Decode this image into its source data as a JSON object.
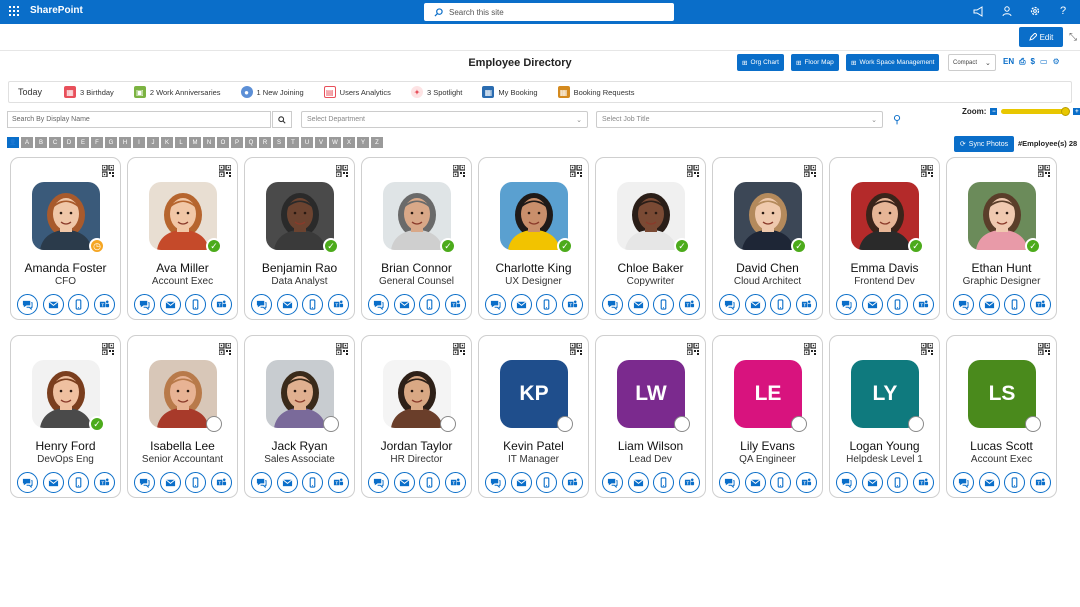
{
  "app": {
    "brand": "SharePoint",
    "search_placeholder": "Search this site",
    "edit_label": "Edit"
  },
  "header": {
    "title": "Employee Directory",
    "buttons": [
      "Org Chart",
      "Floor Map",
      "Work Space Management"
    ],
    "view_mode": "Compact",
    "language": "EN",
    "currency": "$"
  },
  "tabs": [
    {
      "label": "Today",
      "icon": "",
      "color": ""
    },
    {
      "label": "3 Birthday",
      "icon": "cake-icon",
      "color": "#e8505b"
    },
    {
      "label": "2 Work Anniversaries",
      "icon": "gift-icon",
      "color": "#7cb342"
    },
    {
      "label": "1 New Joining",
      "icon": "users-icon",
      "color": "#5c8fd6"
    },
    {
      "label": "Users Analytics",
      "icon": "analytics-icon",
      "color": "#e8505b"
    },
    {
      "label": "3 Spotlight",
      "icon": "spotlight-icon",
      "color": "#e8505b"
    },
    {
      "label": "My Booking",
      "icon": "calendar-icon",
      "color": "#2b6cb0"
    },
    {
      "label": "Booking Requests",
      "icon": "booking-icon",
      "color": "#d48a1f"
    }
  ],
  "filters": {
    "search_placeholder": "Search By Display Name",
    "department_placeholder": "Select Department",
    "job_title_placeholder": "Select Job Title",
    "zoom_label": "Zoom:",
    "zoom_level": 0.95
  },
  "alphabet": [
    "A",
    "B",
    "C",
    "D",
    "E",
    "F",
    "G",
    "H",
    "I",
    "J",
    "K",
    "L",
    "M",
    "N",
    "O",
    "P",
    "Q",
    "R",
    "S",
    "T",
    "U",
    "V",
    "W",
    "X",
    "Y",
    "Z"
  ],
  "sync_label": "Sync Photos",
  "employee_count": "#Employee(s) 28",
  "employees": [
    {
      "name": "Amanda Foster",
      "title": "CFO",
      "status": "away",
      "photo": "photo",
      "skin": "#f0c7a8",
      "hair": "#a85a2c",
      "bg": "#3a5a7a",
      "shirt": "#2b3b4b"
    },
    {
      "name": "Ava Miller",
      "title": "Account Exec",
      "status": "available",
      "photo": "photo",
      "skin": "#f1c7a6",
      "hair": "#b6652e",
      "bg": "#e8ded2",
      "shirt": "#c54a2a"
    },
    {
      "name": "Benjamin Rao",
      "title": "Data Analyst",
      "status": "available",
      "photo": "photo",
      "skin": "#6b4330",
      "hair": "#2a2a2a",
      "bg": "#4a4a4a",
      "shirt": "#3a3a3a"
    },
    {
      "name": "Brian Connor",
      "title": "General Counsel",
      "status": "available",
      "photo": "photo",
      "skin": "#d9a888",
      "hair": "#6a6a6a",
      "bg": "#dfe4e6",
      "shirt": "#cfcfcf"
    },
    {
      "name": "Charlotte King",
      "title": "UX Designer",
      "status": "available",
      "photo": "photo",
      "skin": "#c98f6b",
      "hair": "#1f1a18",
      "bg": "#5aa0d0",
      "shirt": "#f2c300"
    },
    {
      "name": "Chloe Baker",
      "title": "Copywriter",
      "status": "available",
      "photo": "photo",
      "skin": "#7a4a34",
      "hair": "#2a1e18",
      "bg": "#f0f0f0",
      "shirt": "#e6e6e6"
    },
    {
      "name": "David Chen",
      "title": "Cloud Architect",
      "status": "available",
      "photo": "photo",
      "skin": "#efc9ad",
      "hair": "#b48a5c",
      "bg": "#3c4756",
      "shirt": "#1e2636"
    },
    {
      "name": "Emma Davis",
      "title": "Frontend Dev",
      "status": "available",
      "photo": "photo",
      "skin": "#e6b596",
      "hair": "#3a241a",
      "bg": "#b42a2a",
      "shirt": "#2a2a2a"
    },
    {
      "name": "Ethan Hunt",
      "title": "Graphic Designer",
      "status": "available",
      "photo": "photo",
      "skin": "#f0c9b0",
      "hair": "#5a3e2a",
      "bg": "#6b8b5a",
      "shirt": "#e89aa8"
    },
    {
      "name": "Henry Ford",
      "title": "DevOps Eng",
      "status": "available",
      "photo": "photo",
      "skin": "#efc0a0",
      "hair": "#7a3e1e",
      "bg": "#f2f2f2",
      "shirt": "#4a4a4a"
    },
    {
      "name": "Isabella Lee",
      "title": "Senior Accountant",
      "status": "offline",
      "photo": "photo",
      "skin": "#e8b394",
      "hair": "#b87a4a",
      "bg": "#d8c7b8",
      "shirt": "#a83a2a"
    },
    {
      "name": "Jack Ryan",
      "title": "Sales Associate",
      "status": "offline",
      "photo": "photo",
      "skin": "#e0b090",
      "hair": "#3a2a1a",
      "bg": "#c8ccd0",
      "shirt": "#7a6a9a"
    },
    {
      "name": "Jordan Taylor",
      "title": "HR Director",
      "status": "offline",
      "photo": "photo",
      "skin": "#d9a884",
      "hair": "#2e2018",
      "bg": "#f4f4f4",
      "shirt": "#6a3e2a"
    },
    {
      "name": "Kevin Patel",
      "title": "IT Manager",
      "status": "offline",
      "photo": "initials",
      "initials": "KP",
      "color": "#1f4e8c"
    },
    {
      "name": "Liam Wilson",
      "title": "Lead Dev",
      "status": "offline",
      "photo": "initials",
      "initials": "LW",
      "color": "#7b2a8e"
    },
    {
      "name": "Lily Evans",
      "title": "QA Engineer",
      "status": "offline",
      "photo": "initials",
      "initials": "LE",
      "color": "#d8137e"
    },
    {
      "name": "Logan Young",
      "title": "Helpdesk Level 1",
      "status": "offline",
      "photo": "initials",
      "initials": "LY",
      "color": "#0f7a7e"
    },
    {
      "name": "Lucas Scott",
      "title": "Account Exec",
      "status": "offline",
      "photo": "initials",
      "initials": "LS",
      "color": "#4a8a1c"
    }
  ],
  "colors": {
    "accent": "#0a6ec9",
    "available": "#4cab1b",
    "away": "#f5a623"
  }
}
